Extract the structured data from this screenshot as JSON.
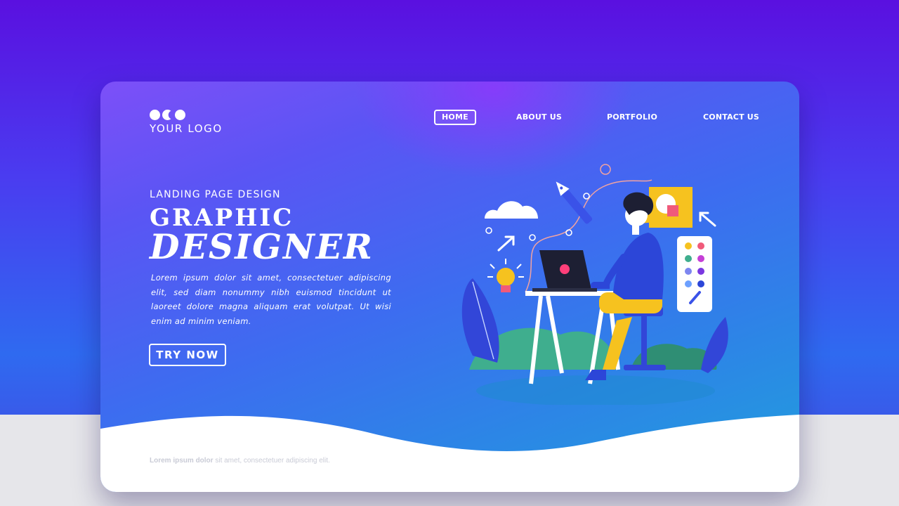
{
  "logo": {
    "text": "YOUR LOGO"
  },
  "nav": {
    "items": [
      {
        "label": "HOME",
        "active": true
      },
      {
        "label": "ABOUT US",
        "active": false
      },
      {
        "label": "PORTFOLIO",
        "active": false
      },
      {
        "label": "CONTACT US",
        "active": false
      }
    ]
  },
  "hero": {
    "subtitle": "LANDING PAGE DESIGN",
    "title_line1": "GRAPHIC",
    "title_line2": "DESIGNER",
    "body": "Lorem ipsum dolor sit amet, consectetuer adipiscing elit, sed diam nonummy nibh euismod tincidunt ut laoreet dolore magna aliquam erat volutpat. Ut wisi enim ad minim veniam.",
    "cta_label": "TRY NOW"
  },
  "footer": {
    "bold": "Lorem ipsum dolor",
    "rest": " sit amet, consectetuer adipiscing elit."
  },
  "illustration": {
    "icons": [
      "cloud-icon",
      "pen-tool-icon",
      "lightbulb-icon",
      "arrow-icon",
      "shape-chat-icon",
      "color-palette-icon",
      "laptop-icon",
      "designer-person",
      "desk",
      "plant-leaf"
    ]
  },
  "colors": {
    "bg_top": "#5a10e0",
    "card_top": "#7d4ff8",
    "card_bottom": "#20a0dc",
    "accent_yellow": "#f6c21f",
    "laptop_dark": "#1d1f33",
    "laptop_button": "#ff3f7a"
  }
}
